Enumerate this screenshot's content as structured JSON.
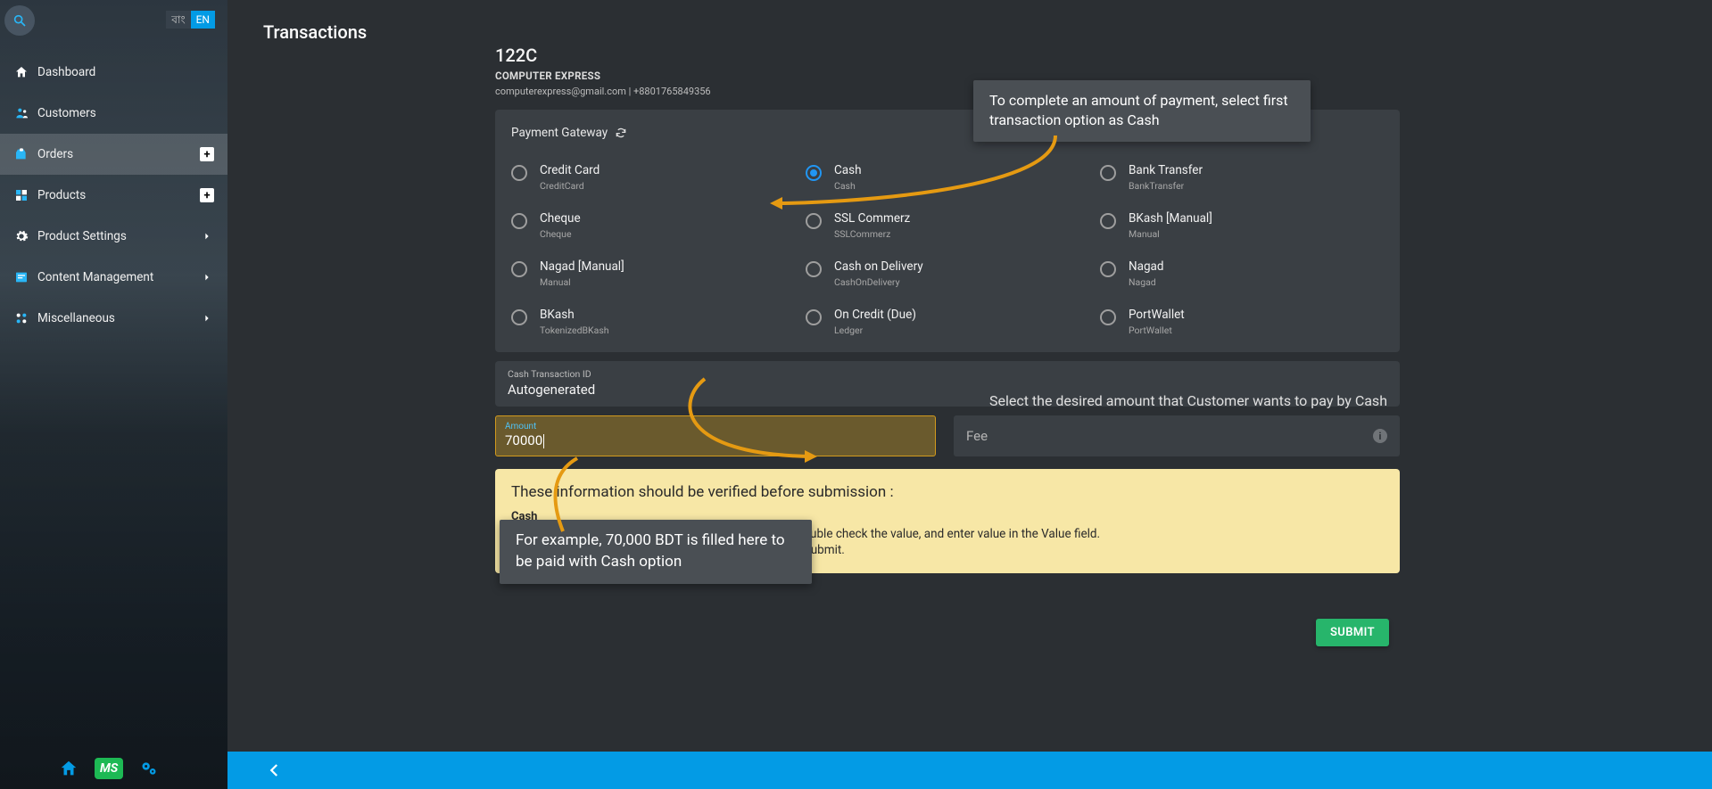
{
  "lang": {
    "bn": "বাং",
    "en": "EN"
  },
  "sidebar": {
    "items": [
      {
        "label": "Dashboard"
      },
      {
        "label": "Customers"
      },
      {
        "label": "Orders"
      },
      {
        "label": "Products"
      },
      {
        "label": "Product Settings"
      },
      {
        "label": "Content Management"
      },
      {
        "label": "Miscellaneous"
      }
    ],
    "bottom": {
      "ms": "MS"
    }
  },
  "page": {
    "title": "Transactions"
  },
  "order": {
    "id": "122C",
    "company": "COMPUTER EXPRESS",
    "contact": "computerexpress@gmail.com | +8801765849356"
  },
  "gateway": {
    "label": "Payment Gateway",
    "selected": "cash",
    "options": [
      {
        "key": "creditcard",
        "title": "Credit Card",
        "sub": "CreditCard"
      },
      {
        "key": "cash",
        "title": "Cash",
        "sub": "Cash"
      },
      {
        "key": "banktransfer",
        "title": "Bank Transfer",
        "sub": "BankTransfer"
      },
      {
        "key": "cheque",
        "title": "Cheque",
        "sub": "Cheque"
      },
      {
        "key": "sslcommerz",
        "title": "SSL Commerz",
        "sub": "SSLCommerz"
      },
      {
        "key": "bkashmanual",
        "title": "BKash [Manual]",
        "sub": "Manual"
      },
      {
        "key": "nagadmanual",
        "title": "Nagad [Manual]",
        "sub": "Manual"
      },
      {
        "key": "cod",
        "title": "Cash on Delivery",
        "sub": "CashOnDelivery"
      },
      {
        "key": "nagad",
        "title": "Nagad",
        "sub": "Nagad"
      },
      {
        "key": "bkash",
        "title": "BKash",
        "sub": "TokenizedBKash"
      },
      {
        "key": "oncredit",
        "title": "On Credit (Due)",
        "sub": "Ledger"
      },
      {
        "key": "portwallet",
        "title": "PortWallet",
        "sub": "PortWallet"
      }
    ]
  },
  "txid": {
    "label": "Cash Transaction ID",
    "value": "Autogenerated",
    "hint": "Select the desired amount that Customer wants to pay by Cash"
  },
  "amount": {
    "label": "Amount",
    "value": "70000"
  },
  "fee": {
    "placeholder": "Fee"
  },
  "verify": {
    "title": "These information should be verified before submission :",
    "subtitle": "Cash",
    "steps": [
      "After customer has paid for product at your shop, double check the value, and enter value in the Value field.",
      "Complete the transaction for your order by clicking Submit."
    ]
  },
  "submit": {
    "label": "SUBMIT"
  },
  "callouts": {
    "c1": "To complete an amount of payment, select first transaction option as Cash",
    "c3": "For example, 70,000 BDT is filled here to be paid with Cash option"
  }
}
